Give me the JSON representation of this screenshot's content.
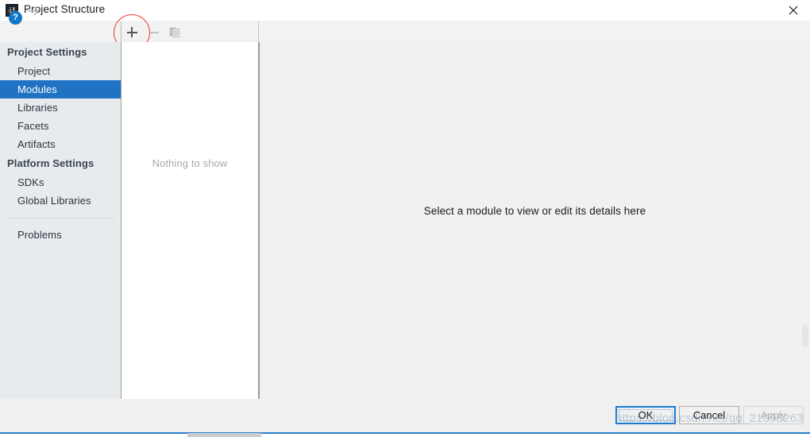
{
  "window": {
    "title": "Project Structure",
    "app_icon": "IJ",
    "close_icon": "close-icon"
  },
  "toolbar": {
    "back_icon": "arrow-left-icon",
    "forward_icon": "arrow-right-icon",
    "add_label": "+",
    "remove_label": "−",
    "copy_icon": "copy-icon"
  },
  "annotation": {
    "shape": "circle",
    "color": "#ef4444",
    "target": "add-module-button"
  },
  "sidebar": {
    "groups": [
      {
        "title": "Project Settings",
        "items": [
          {
            "label": "Project",
            "selected": false
          },
          {
            "label": "Modules",
            "selected": true
          },
          {
            "label": "Libraries",
            "selected": false
          },
          {
            "label": "Facets",
            "selected": false
          },
          {
            "label": "Artifacts",
            "selected": false
          }
        ]
      },
      {
        "title": "Platform Settings",
        "items": [
          {
            "label": "SDKs",
            "selected": false
          },
          {
            "label": "Global Libraries",
            "selected": false
          }
        ]
      }
    ],
    "problems_label": "Problems",
    "selected_color": "#1f72c4"
  },
  "list_panel": {
    "empty_text": "Nothing to show"
  },
  "detail_panel": {
    "message": "Select a module to view or edit its details here"
  },
  "footer": {
    "help_label": "?",
    "ok_label": "OK",
    "cancel_label": "Cancel",
    "apply_label": "Apply"
  },
  "watermark": {
    "text": "https://blog.csdn.net/qq_21098263"
  }
}
